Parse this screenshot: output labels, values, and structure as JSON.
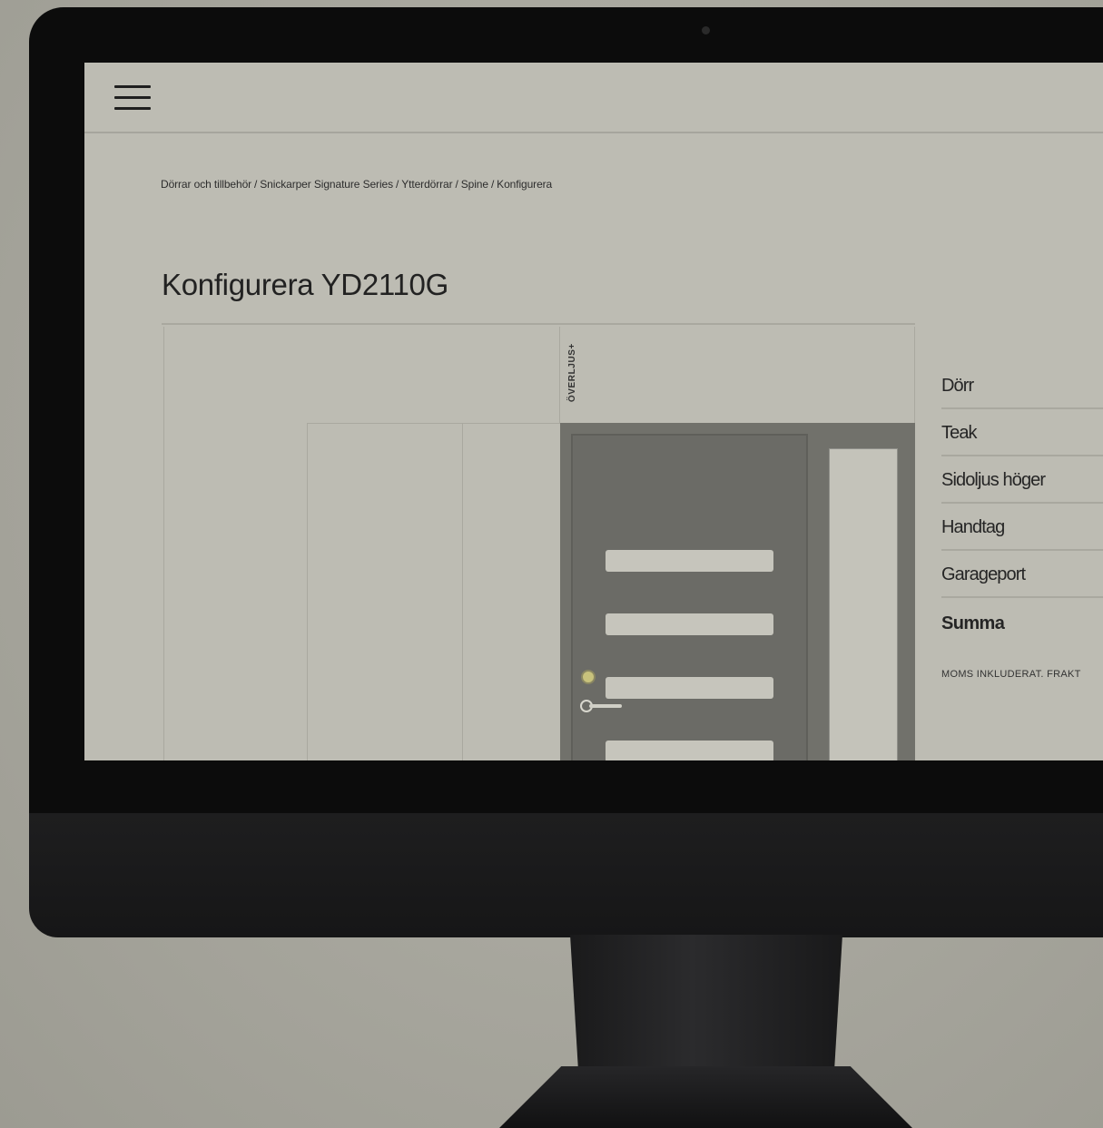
{
  "nav": {
    "menu_icon": "hamburger-menu-icon"
  },
  "breadcrumb": {
    "items": [
      "Dörrar och tillbehör",
      "Snickarper Signature Series",
      "Ytterdörrar",
      "Spine",
      "Konfigurera"
    ],
    "separator": "/"
  },
  "page": {
    "title": "Konfigurera YD2110G"
  },
  "preview": {
    "transom_label": "ÖVERLJUS+"
  },
  "summary": {
    "rows": [
      "Dörr",
      "Teak",
      "Sidoljus höger",
      "Handtag",
      "Garageport"
    ],
    "total_label": "Summa",
    "note": "MOMS INKLUDERAT. FRAKT"
  },
  "colors": {
    "screen_bg": "#bdbcb3",
    "door": "#6b6b66",
    "wall": "#71716b",
    "lock": "#c8c27c"
  }
}
